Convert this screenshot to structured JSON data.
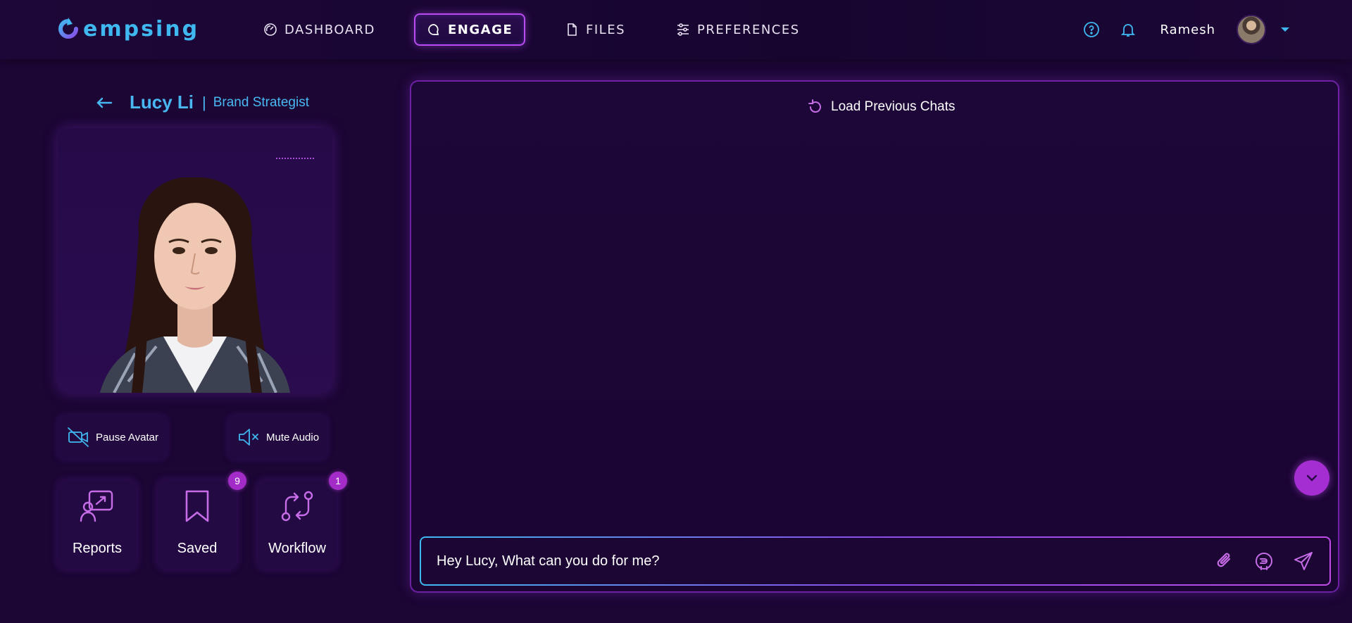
{
  "app": {
    "logo_text": "empsing"
  },
  "nav": {
    "items": [
      {
        "label": "DASHBOARD",
        "icon": "gauge-icon"
      },
      {
        "label": "ENGAGE",
        "icon": "chat-icon",
        "active": true
      },
      {
        "label": "FILES",
        "icon": "file-icon"
      },
      {
        "label": "PREFERENCES",
        "icon": "sliders-icon"
      }
    ]
  },
  "user": {
    "name": "Ramesh"
  },
  "agent": {
    "name": "Lucy Li",
    "separator": "|",
    "role": "Brand Strategist"
  },
  "controls": {
    "pause_avatar": "Pause Avatar",
    "mute_audio": "Mute Audio"
  },
  "tiles": [
    {
      "label": "Reports",
      "icon": "reports-icon",
      "badge": null
    },
    {
      "label": "Saved",
      "icon": "bookmark-icon",
      "badge": "9"
    },
    {
      "label": "Workflow",
      "icon": "workflow-icon",
      "badge": "1"
    }
  ],
  "chat": {
    "load_previous": "Load Previous Chats",
    "input_value": "Hey Lucy, What can you do for me?"
  },
  "colors": {
    "background": "#1b0634",
    "accent_blue": "#3fb8f0",
    "accent_purple": "#b84cf0",
    "badge": "#a32cc8"
  }
}
